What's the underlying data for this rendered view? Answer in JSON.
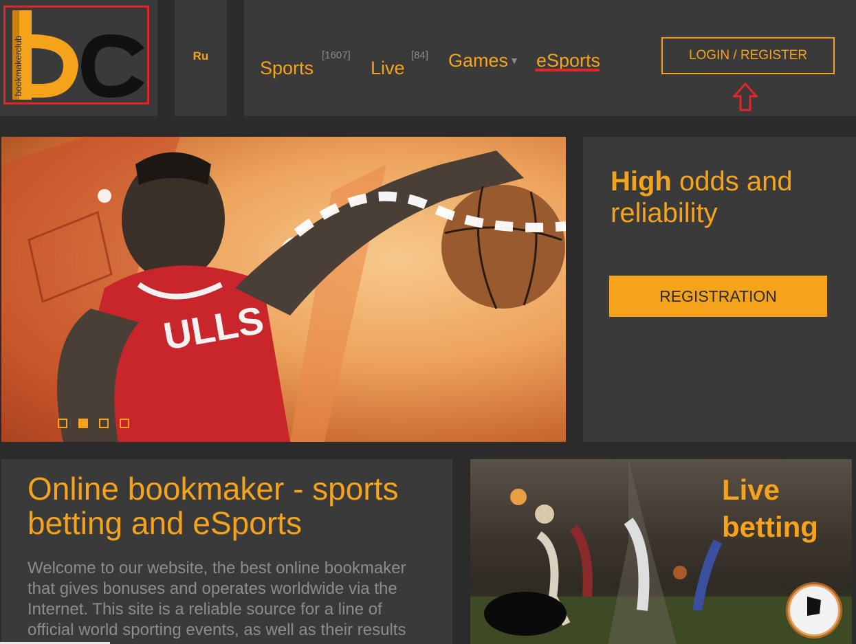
{
  "brand": {
    "logo_text": "bookmakerclub"
  },
  "header": {
    "language": "Ru",
    "nav": [
      {
        "label": "Sports",
        "count": "[1607]"
      },
      {
        "label": "Live",
        "count": "[84]"
      },
      {
        "label": "Games"
      },
      {
        "label": "eSports"
      }
    ],
    "login_label": "LOGIN / REGISTER"
  },
  "hero": {
    "headline_bold": "High",
    "headline_rest": " odds and reliability",
    "registration_label": "REGISTRATION",
    "slides": {
      "count": 4,
      "active": 2
    }
  },
  "about": {
    "title": "Online bookmaker - sports betting and eSports",
    "text": "Welcome to our website, the best online bookmaker that gives bonuses and operates worldwide via the Internet. This site is a reliable source for a line of official world sporting events, as well as their results"
  },
  "live_promo": {
    "title_line1": "Live",
    "title_line2": "betting"
  },
  "colors": {
    "accent": "#f5a31a",
    "highlight": "#e3262a",
    "panel": "#3a3a3a",
    "background": "#2b2b2b"
  }
}
